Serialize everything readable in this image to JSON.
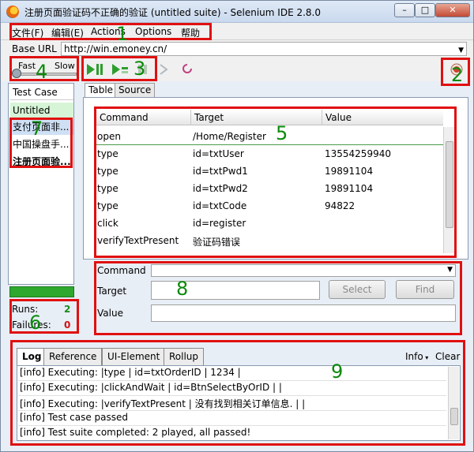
{
  "window": {
    "title": "注册页面验证码不正确的验证 (untitled suite) - Selenium IDE 2.8.0",
    "minimize_glyph": "–",
    "maximize_glyph": "□",
    "close_glyph": "✕"
  },
  "menu": [
    "文件(F)",
    "编辑(E)",
    "Actions",
    "Options",
    "帮助"
  ],
  "base_url": {
    "label": "Base URL",
    "value": "http://win.emoney.cn/"
  },
  "speed": {
    "fast": "Fast",
    "slow": "Slow"
  },
  "editor_tabs": [
    "Table",
    "Source"
  ],
  "test_cases": {
    "header": "Test Case",
    "items": [
      "Untitled",
      "支付页面非...",
      "中国操盘手...",
      "注册页面验..."
    ]
  },
  "stats": {
    "runs_label": "Runs:",
    "runs": "2",
    "failures_label": "Failures:",
    "failures": "0"
  },
  "command_table": {
    "columns": [
      "Command",
      "Target",
      "Value"
    ],
    "rows": [
      {
        "command": "open",
        "target": "/Home/Register",
        "value": ""
      },
      {
        "command": "type",
        "target": "id=txtUser",
        "value": "13554259940"
      },
      {
        "command": "type",
        "target": "id=txtPwd1",
        "value": "19891104"
      },
      {
        "command": "type",
        "target": "id=txtPwd2",
        "value": "19891104"
      },
      {
        "command": "type",
        "target": "id=txtCode",
        "value": "94822"
      },
      {
        "command": "click",
        "target": "id=register",
        "value": ""
      },
      {
        "command": "verifyTextPresent",
        "target": "验证码错误",
        "value": ""
      }
    ]
  },
  "editor": {
    "command_label": "Command",
    "target_label": "Target",
    "value_label": "Value",
    "select_button": "Select",
    "find_button": "Find"
  },
  "log": {
    "tabs": [
      "Log",
      "Reference",
      "UI-Element",
      "Rollup"
    ],
    "info_menu": "Info",
    "clear_button": "Clear",
    "lines": [
      "[info] Executing: |type | id=txtOrderID | 1234 |",
      "[info] Executing: |clickAndWait | id=BtnSelectByOrID | |",
      "[info] Executing: |verifyTextPresent | 没有找到相关订单信息. | |",
      "[info] Test case passed",
      "[info] Test suite completed: 2 played, all passed!"
    ]
  },
  "annotations": [
    "1",
    "2",
    "3",
    "4",
    "5",
    "6",
    "7",
    "8",
    "9"
  ],
  "colors": {
    "annotation_box": "#e01010",
    "annotation_number": "#0a8a0a",
    "progress": "#2ea82e"
  }
}
